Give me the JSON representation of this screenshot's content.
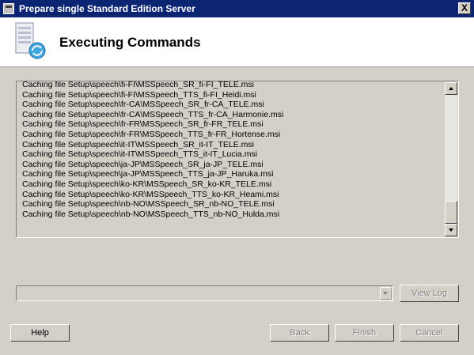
{
  "window": {
    "title": "Prepare single Standard Edition Server",
    "close_glyph": "X"
  },
  "header": {
    "title": "Executing Commands",
    "icon": "server-sync-icon"
  },
  "log": {
    "lines": [
      "Caching file Setup\\speech\\fi-FI\\MSSpeech_SR_fi-FI_TELE.msi",
      "Caching file Setup\\speech\\fi-FI\\MSSpeech_TTS_fi-FI_Heidi.msi",
      "Caching file Setup\\speech\\fr-CA\\MSSpeech_SR_fr-CA_TELE.msi",
      "Caching file Setup\\speech\\fr-CA\\MSSpeech_TTS_fr-CA_Harmonie.msi",
      "Caching file Setup\\speech\\fr-FR\\MSSpeech_SR_fr-FR_TELE.msi",
      "Caching file Setup\\speech\\fr-FR\\MSSpeech_TTS_fr-FR_Hortense.msi",
      "Caching file Setup\\speech\\it-IT\\MSSpeech_SR_it-IT_TELE.msi",
      "Caching file Setup\\speech\\it-IT\\MSSpeech_TTS_it-IT_Lucia.msi",
      "Caching file Setup\\speech\\ja-JP\\MSSpeech_SR_ja-JP_TELE.msi",
      "Caching file Setup\\speech\\ja-JP\\MSSpeech_TTS_ja-JP_Haruka.msi",
      "Caching file Setup\\speech\\ko-KR\\MSSpeech_SR_ko-KR_TELE.msi",
      "Caching file Setup\\speech\\ko-KR\\MSSpeech_TTS_ko-KR_Heami.msi",
      "Caching file Setup\\speech\\nb-NO\\MSSpeech_SR_nb-NO_TELE.msi",
      "Caching file Setup\\speech\\nb-NO\\MSSpeech_TTS_nb-NO_Hulda.msi"
    ]
  },
  "combo": {
    "value": ""
  },
  "buttons": {
    "view_log": "View Log",
    "help": "Help",
    "back": "Back",
    "finish": "Finish",
    "cancel": "Cancel"
  },
  "colors": {
    "titlebar": "#0b2573",
    "dialog": "#d4d0c8",
    "header_bg": "#ffffff"
  }
}
